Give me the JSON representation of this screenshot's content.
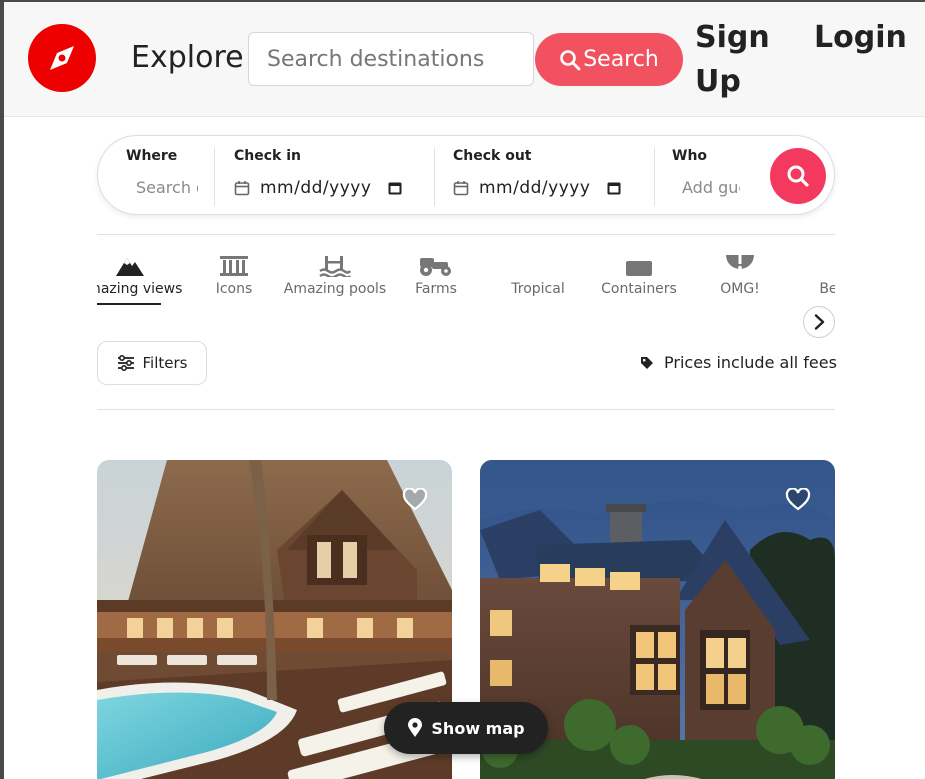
{
  "header": {
    "brand_label": "Explore",
    "search_placeholder": "Search destinations",
    "search_button": "Search",
    "signup_label": "Sign Up",
    "login_label": "Login"
  },
  "search_bar": {
    "where_label": "Where",
    "where_placeholder": "Search destinations",
    "checkin_label": "Check in",
    "checkin_value": "mm/dd/yyyy",
    "checkout_label": "Check out",
    "checkout_value": "mm/dd/yyyy",
    "who_label": "Who",
    "who_placeholder": "Add guests"
  },
  "categories": [
    {
      "label": "Amazing views",
      "icon": "mountain-icon",
      "active": true
    },
    {
      "label": "Icons",
      "icon": "columns-icon"
    },
    {
      "label": "Amazing pools",
      "icon": "pool-icon"
    },
    {
      "label": "Farms",
      "icon": "tractor-icon"
    },
    {
      "label": "Tropical",
      "icon": "palm-icon"
    },
    {
      "label": "Containers",
      "icon": "container-icon"
    },
    {
      "label": "OMG!",
      "icon": "exclamation-icon"
    },
    {
      "label": "Beach",
      "icon": "beach-icon"
    }
  ],
  "toolbar": {
    "filters_label": "Filters",
    "fees_label": "Prices include all fees"
  },
  "listings": [
    {
      "image": "tropical lodge with pool",
      "favorite": false
    },
    {
      "image": "wooden house at dusk",
      "favorite": false
    }
  ],
  "show_map_label": "Show map",
  "colors": {
    "brand_red": "#ee0000",
    "search_button": "#f25260",
    "search_go": "#f4395f",
    "dark": "#222222"
  }
}
